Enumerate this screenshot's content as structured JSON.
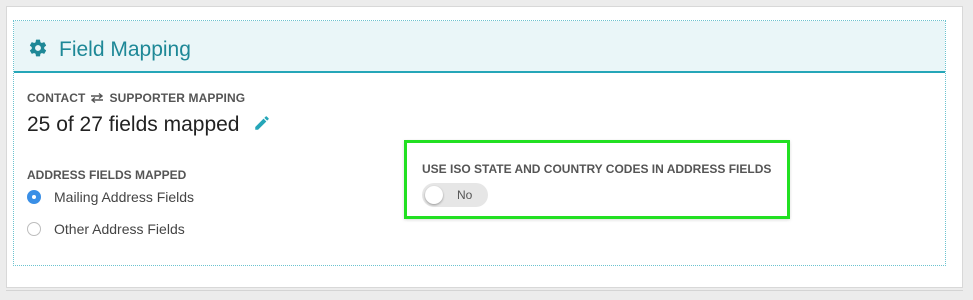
{
  "panel": {
    "title": "Field Mapping",
    "icon": "gear-icon",
    "accent_color": "#1e8897"
  },
  "mapping": {
    "left_label": "CONTACT",
    "swap_icon": "swap-arrows-icon",
    "right_label": "SUPPORTER MAPPING",
    "summary": "25 of 27 fields mapped",
    "edit_icon": "pencil-icon"
  },
  "address_fields": {
    "label": "ADDRESS FIELDS MAPPED",
    "options": [
      {
        "label": "Mailing Address Fields",
        "selected": true
      },
      {
        "label": "Other Address Fields",
        "selected": false
      }
    ]
  },
  "iso_setting": {
    "label": "USE ISO STATE AND COUNTRY CODES IN ADDRESS FIELDS",
    "toggle_value": "No",
    "enabled": false,
    "highlight_color": "#22e022"
  }
}
